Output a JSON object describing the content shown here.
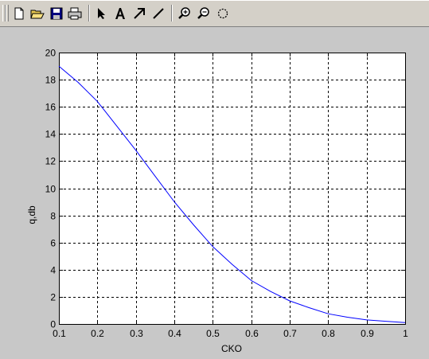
{
  "toolbar": {
    "buttons": [
      {
        "name": "new-figure",
        "icon": "new-document-icon"
      },
      {
        "name": "open-file",
        "icon": "folder-open-icon"
      },
      {
        "name": "save-figure",
        "icon": "floppy-disk-icon"
      },
      {
        "name": "print-figure",
        "icon": "printer-icon"
      },
      {
        "name": "edit-plot",
        "icon": "arrow-pointer-icon"
      },
      {
        "name": "insert-text",
        "icon": "text-a-icon"
      },
      {
        "name": "insert-arrow",
        "icon": "diagonal-arrow-icon"
      },
      {
        "name": "insert-line",
        "icon": "diagonal-line-icon"
      },
      {
        "name": "zoom-in",
        "icon": "zoom-in-icon"
      },
      {
        "name": "zoom-out",
        "icon": "zoom-out-icon"
      },
      {
        "name": "rotate-3d",
        "icon": "rotate-icon"
      }
    ]
  },
  "colors": {
    "figure_bg": "#c8c8c8",
    "axes_bg": "#ffffff",
    "line": "#0000ff",
    "grid": "#000000"
  },
  "chart_data": {
    "type": "line",
    "xlabel": "CKO",
    "ylabel": "q,db",
    "xlim": [
      0.1,
      1
    ],
    "ylim": [
      0,
      20
    ],
    "xticks": [
      "0.1",
      "0.2",
      "0.3",
      "0.4",
      "0.5",
      "0.6",
      "0.7",
      "0.8",
      "0.9",
      "1"
    ],
    "yticks": [
      "0",
      "2",
      "4",
      "6",
      "8",
      "10",
      "12",
      "14",
      "16",
      "18",
      "20"
    ],
    "grid": true,
    "grid_style": "dashed",
    "series": [
      {
        "color": "#0000ff",
        "x": [
          0.1,
          0.15,
          0.2,
          0.25,
          0.3,
          0.35,
          0.4,
          0.45,
          0.5,
          0.55,
          0.6,
          0.65,
          0.7,
          0.75,
          0.8,
          0.85,
          0.9,
          0.95,
          1.0
        ],
        "y": [
          19.0,
          17.8,
          16.4,
          14.6,
          12.8,
          10.9,
          9.0,
          7.3,
          5.7,
          4.4,
          3.2,
          2.4,
          1.7,
          1.2,
          0.75,
          0.5,
          0.3,
          0.2,
          0.1
        ]
      }
    ]
  }
}
